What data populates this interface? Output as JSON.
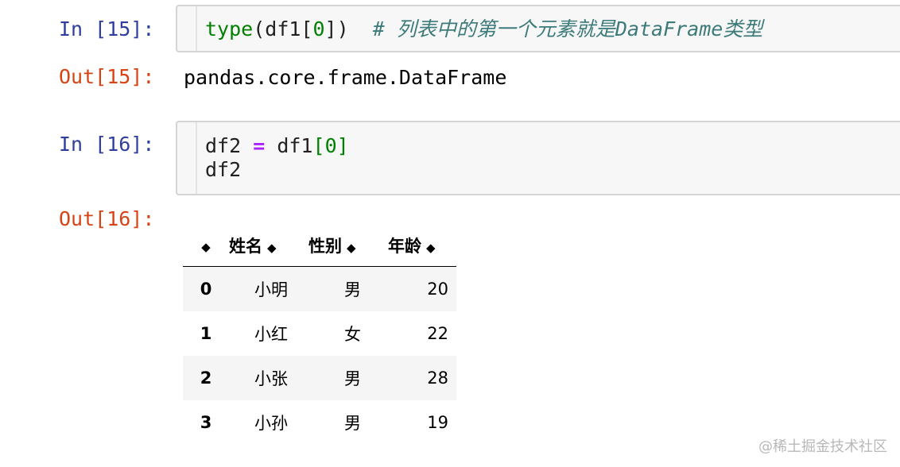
{
  "cell15": {
    "in_prompt": "In [15]:",
    "code": {
      "fn": "type",
      "open": "(df1[",
      "index": "0",
      "close": "])",
      "comment": "# 列表中的第一个元素就是DataFrame类型"
    },
    "out_prompt": "Out[15]:",
    "output": "pandas.core.frame.DataFrame"
  },
  "cell16": {
    "in_prompt": "In [16]:",
    "line1": {
      "lhs": "df2 ",
      "op": "=",
      "rhs": " df1",
      "lb": "[",
      "index": "0",
      "rb": "]"
    },
    "line2": "df2",
    "out_prompt": "Out[16]:"
  },
  "table": {
    "sort_glyph": "◆",
    "columns": [
      "姓名",
      "性别",
      "年龄"
    ],
    "rows": [
      {
        "idx": "0",
        "name": "小明",
        "sex": "男",
        "age": "20"
      },
      {
        "idx": "1",
        "name": "小红",
        "sex": "女",
        "age": "22"
      },
      {
        "idx": "2",
        "name": "小张",
        "sex": "男",
        "age": "28"
      },
      {
        "idx": "3",
        "name": "小孙",
        "sex": "男",
        "age": "19"
      }
    ]
  },
  "watermark": "@稀土掘金技术社区"
}
